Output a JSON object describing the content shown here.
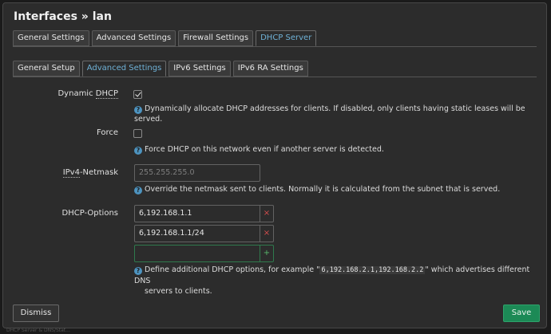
{
  "dialog": {
    "title": "Interfaces » lan"
  },
  "top_tabs": [
    {
      "label": "General Settings",
      "active": false
    },
    {
      "label": "Advanced Settings",
      "active": false
    },
    {
      "label": "Firewall Settings",
      "active": false
    },
    {
      "label": "DHCP Server",
      "active": true
    }
  ],
  "sub_tabs": [
    {
      "label": "General Setup",
      "active": false
    },
    {
      "label": "Advanced Settings",
      "active": true
    },
    {
      "label": "IPv6 Settings",
      "active": false
    },
    {
      "label": "IPv6 RA Settings",
      "active": false
    }
  ],
  "fields": {
    "dynamic_dhcp": {
      "label_prefix": "Dynamic ",
      "label_abbr": "DHCP",
      "checked": true,
      "help": "Dynamically allocate DHCP addresses for clients. If disabled, only clients having static leases will be served."
    },
    "force": {
      "label": "Force",
      "checked": false,
      "help": "Force DHCP on this network even if another server is detected."
    },
    "netmask": {
      "label_abbr": "IPv4",
      "label_suffix": "-Netmask",
      "placeholder": "255.255.255.0",
      "help": "Override the netmask sent to clients. Normally it is calculated from the subnet that is served."
    },
    "dhcp_options": {
      "label": "DHCP-Options",
      "values": [
        "6,192.168.1.1",
        "6,192.168.1.1/24"
      ],
      "help_before": "Define additional DHCP options, for example \"",
      "help_code": "6,192.168.2.1,192.168.2.2",
      "help_after": "\" which advertises different DNS",
      "help_line2": "servers to clients."
    }
  },
  "icons": {
    "help": "?",
    "remove": "×",
    "add": "+"
  },
  "buttons": {
    "dismiss": "Dismiss",
    "save": "Save"
  },
  "backdrop": {
    "text": "DHCP Server & DNS/Stat..."
  },
  "colors": {
    "accent": "#6fb1d6",
    "save": "#1c8a56",
    "remove": "#d24d4d",
    "add": "#56b46a"
  }
}
